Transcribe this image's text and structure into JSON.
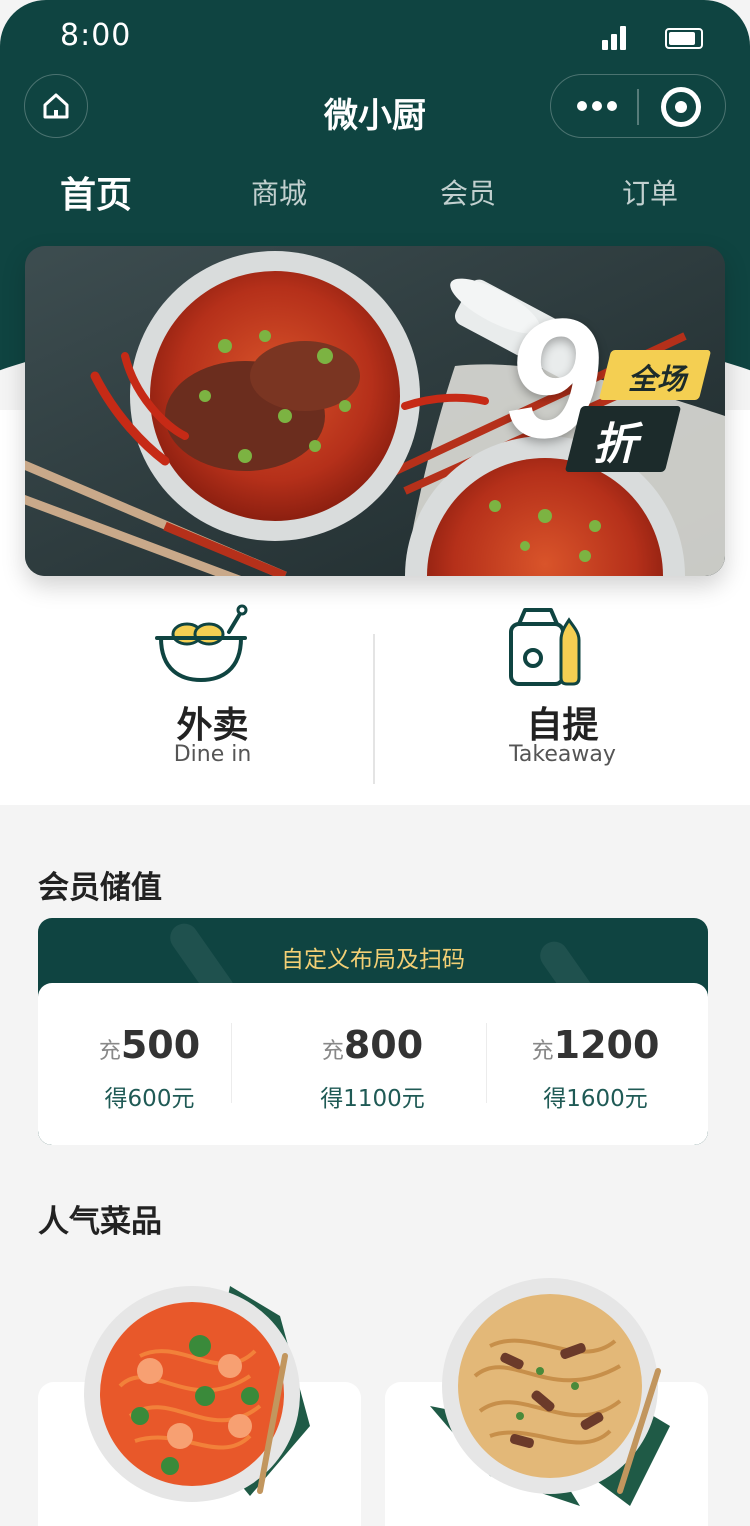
{
  "status": {
    "time": "8:00"
  },
  "nav": {
    "title": "微小厨"
  },
  "tabs": [
    "首页",
    "商城",
    "会员",
    "订单"
  ],
  "banner": {
    "discount_number": "9",
    "badge_top": "全场",
    "badge_bottom": "折"
  },
  "services": [
    {
      "title": "外卖",
      "subtitle": "Dine in",
      "icon": "noodle-bowl-icon"
    },
    {
      "title": "自提",
      "subtitle": "Takeaway",
      "icon": "takeaway-bag-icon"
    }
  ],
  "member": {
    "section_title": "会员储值",
    "card_header": "自定义布局及扫码",
    "tiers": [
      {
        "prefix": "充",
        "amount": "500",
        "reward": "得600元"
      },
      {
        "prefix": "充",
        "amount": "800",
        "reward": "得1100元"
      },
      {
        "prefix": "充",
        "amount": "1200",
        "reward": "得1600元"
      }
    ]
  },
  "popular": {
    "section_title": "人气菜品"
  },
  "colors": {
    "primary": "#0f4441",
    "accent": "#f2cf75",
    "background": "#f4f4f4"
  }
}
